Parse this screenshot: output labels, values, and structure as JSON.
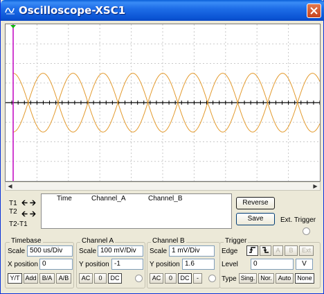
{
  "window": {
    "title": "Oscilloscope-XSC1"
  },
  "colors": {
    "trace": "#e39a2d",
    "cursor": "#c000c0",
    "cursor_marker": "#0db80d",
    "titlebar": "#0a55d5"
  },
  "cursors": {
    "t1_label": "T1",
    "t2_label": "T2",
    "t2t1_label": "T2-T1"
  },
  "readout": {
    "headers": [
      "Time",
      "Channel_A",
      "Channel_B"
    ]
  },
  "buttons": {
    "reverse": "Reverse",
    "save": "Save",
    "ext_trigger": "Ext. Trigger"
  },
  "timebase": {
    "title": "Timebase",
    "scale_label": "Scale",
    "scale_value": "500 us/Div",
    "xpos_label": "X position",
    "xpos_value": "0",
    "modes": [
      "Y/T",
      "Add",
      "B/A",
      "A/B"
    ]
  },
  "channel_a": {
    "title": "Channel A",
    "scale_label": "Scale",
    "scale_value": "100 mV/Div",
    "ypos_label": "Y position",
    "ypos_value": "-1",
    "coupling": [
      "AC",
      "0",
      "DC"
    ]
  },
  "channel_b": {
    "title": "Channel B",
    "scale_label": "Scale",
    "scale_value": "1 mV/Div",
    "ypos_label": "Y position",
    "ypos_value": "1.6",
    "coupling": [
      "AC",
      "0",
      "DC",
      "-"
    ]
  },
  "trigger": {
    "title": "Trigger",
    "edge_label": "Edge",
    "level_label": "Level",
    "level_value": "0",
    "level_unit": "V",
    "sources": [
      "A",
      "B",
      "Ext"
    ],
    "type_label": "Type",
    "types": [
      "Sing.",
      "Nor.",
      "Auto",
      "None"
    ]
  },
  "waveform": {
    "cycles_across_screen": 5.25,
    "amplitude_divisions": 1.5,
    "offset_divisions": 0
  }
}
